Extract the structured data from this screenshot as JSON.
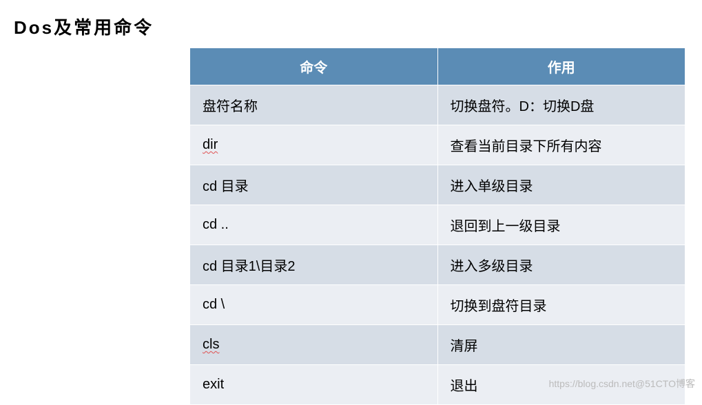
{
  "title": "Dos及常用命令",
  "table": {
    "headers": {
      "command": "命令",
      "description": "作用"
    },
    "rows": [
      {
        "command": "盘符名称",
        "description": "切换盘符。D：切换D盘",
        "spell": false
      },
      {
        "command": "dir",
        "description": "查看当前目录下所有内容",
        "spell": true
      },
      {
        "command": "cd 目录",
        "description": "进入单级目录",
        "spell": false
      },
      {
        "command": "cd ..",
        "description": "退回到上一级目录",
        "spell": false
      },
      {
        "command": "cd 目录1\\目录2",
        "description": "进入多级目录",
        "spell": false
      },
      {
        "command": "cd \\",
        "description": "切换到盘符目录",
        "spell": false
      },
      {
        "command": "cls",
        "description": "清屏",
        "spell": true
      },
      {
        "command": "exit",
        "description": "退出",
        "spell": false
      }
    ]
  },
  "watermark": "https://blog.csdn.net@51CTO博客"
}
